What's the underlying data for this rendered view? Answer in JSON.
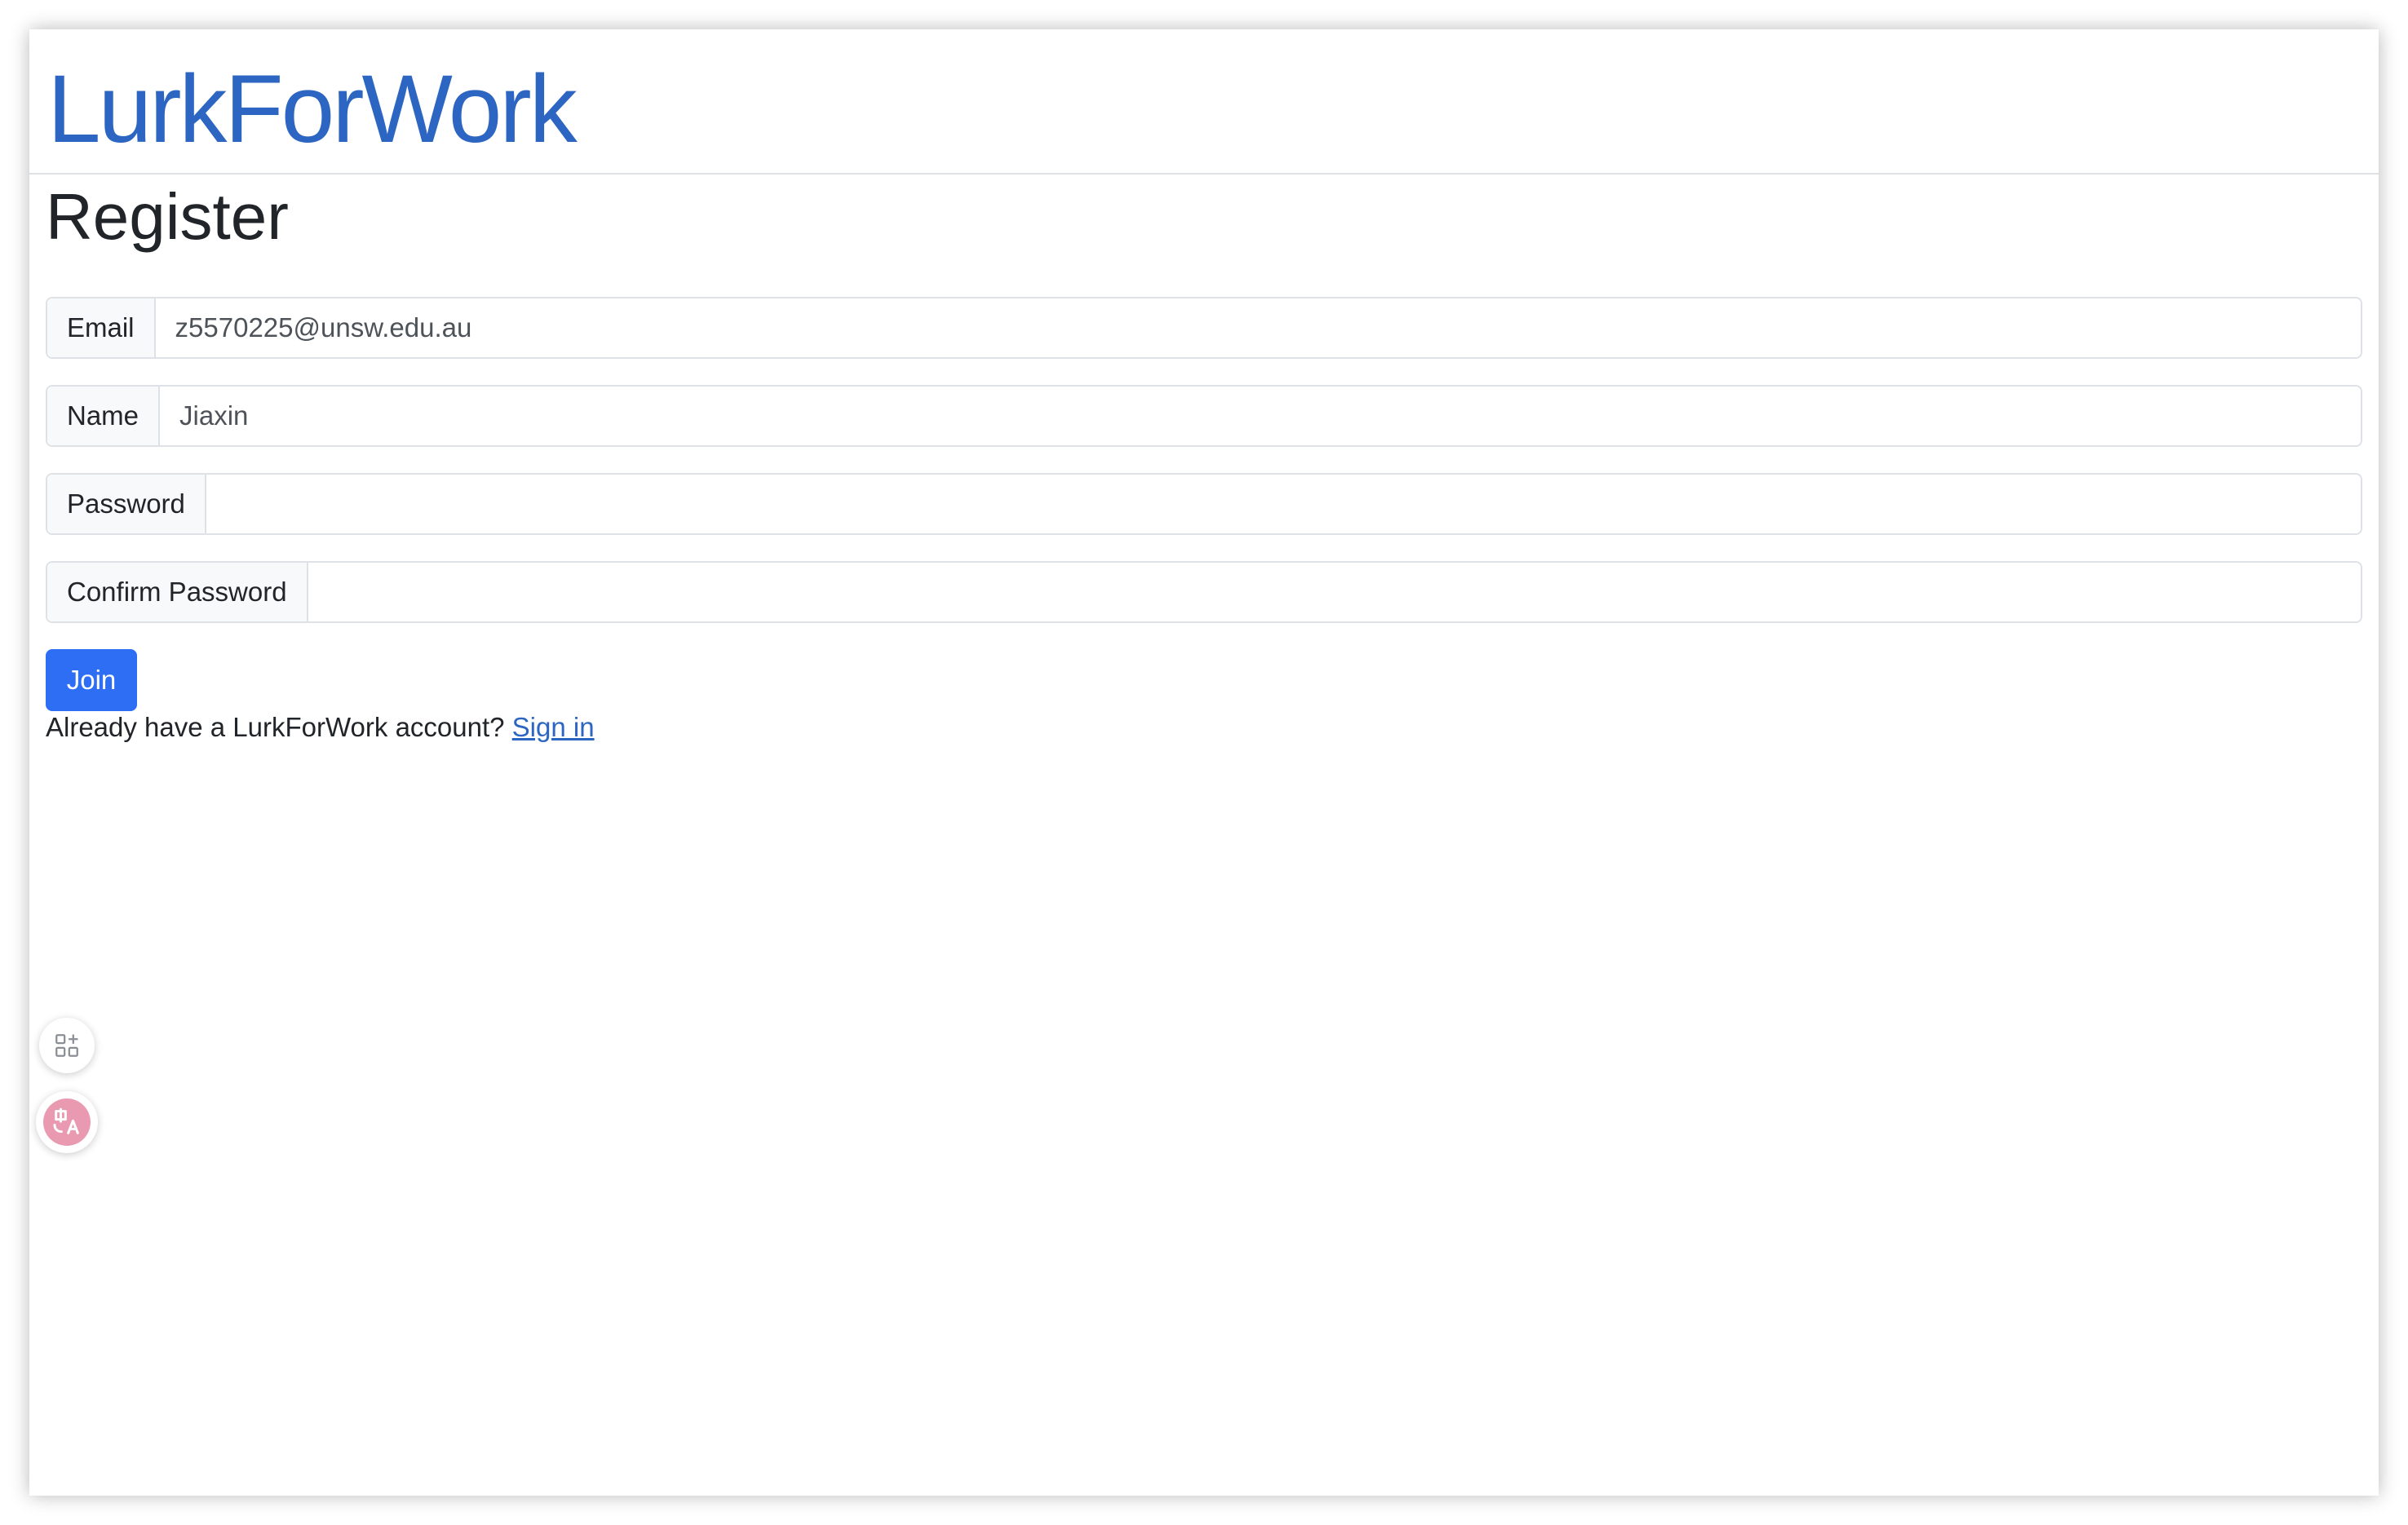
{
  "app": {
    "brand": "LurkForWork"
  },
  "page": {
    "title": "Register"
  },
  "form": {
    "email": {
      "label": "Email",
      "value": "z5570225@unsw.edu.au",
      "placeholder": ""
    },
    "name": {
      "label": "Name",
      "value": "Jiaxin",
      "placeholder": ""
    },
    "password": {
      "label": "Password",
      "value": "",
      "placeholder": ""
    },
    "confirm_password": {
      "label": "Confirm Password",
      "value": "",
      "placeholder": ""
    },
    "join_label": "Join"
  },
  "footer": {
    "prompt": "Already have a LurkForWork account?",
    "signin_link": "Sign in"
  },
  "floating_buttons": {
    "tools_icon": "apps-add-icon",
    "translate_icon": "translate-icon"
  },
  "colors": {
    "brand": "#2c66c2",
    "primary_button": "#2d6ef5",
    "translate_badge": "#e99ab0"
  }
}
